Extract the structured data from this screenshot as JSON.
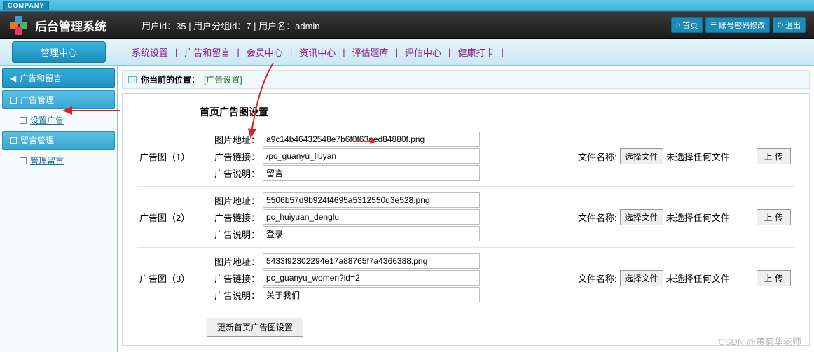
{
  "company_tag": "COMPANY",
  "header": {
    "title": "后台管理系统",
    "info": "用户id：35 | 用户分组id：7 | 用户名：admin",
    "buttons": {
      "home": "首页",
      "pwd": "账号密码修改",
      "logout": "退出"
    }
  },
  "nav": {
    "left": "管理中心",
    "items": [
      "系统设置",
      "广告和留言",
      "会员中心",
      "资讯中心",
      "评估题库",
      "评估中心",
      "健康打卡"
    ]
  },
  "sidebar": {
    "block": "广告和留言",
    "groups": [
      {
        "title": "广告管理",
        "items": [
          {
            "label": "设置广告",
            "active": true
          }
        ]
      },
      {
        "title": "留言管理",
        "items": [
          {
            "label": "管理留言",
            "active": false
          }
        ]
      }
    ]
  },
  "breadcrumb": {
    "prefix": "你当前的位置：",
    "current": "[广告设置]"
  },
  "content": {
    "title": "首页广告图设置",
    "labels": {
      "img_url": "图片地址：",
      "link": "广告链接：",
      "desc": "广告说明：",
      "file_name": "文件名称:",
      "choose": "选择文件",
      "no_file": "未选择任何文件",
      "upload": "上 传"
    },
    "ads": [
      {
        "name": "广告图（1）",
        "img": "a9c14b46432548e7b6f0f63aed84880f.png",
        "link": "/pc_guanyu_liuyan",
        "desc": "留言"
      },
      {
        "name": "广告图（2）",
        "img": "5506b57d9b924f4695a5312550d3e528.png",
        "link": "pc_huiyuan_denglu",
        "desc": "登录"
      },
      {
        "name": "广告图（3）",
        "img": "5433f92302294e17a88765f7a4366388.png",
        "link": "pc_guanyu_women?id=2",
        "desc": "关于我们"
      }
    ],
    "submit": "更新首页广告图设置"
  },
  "watermark": "CSDN @黄菊华老师"
}
